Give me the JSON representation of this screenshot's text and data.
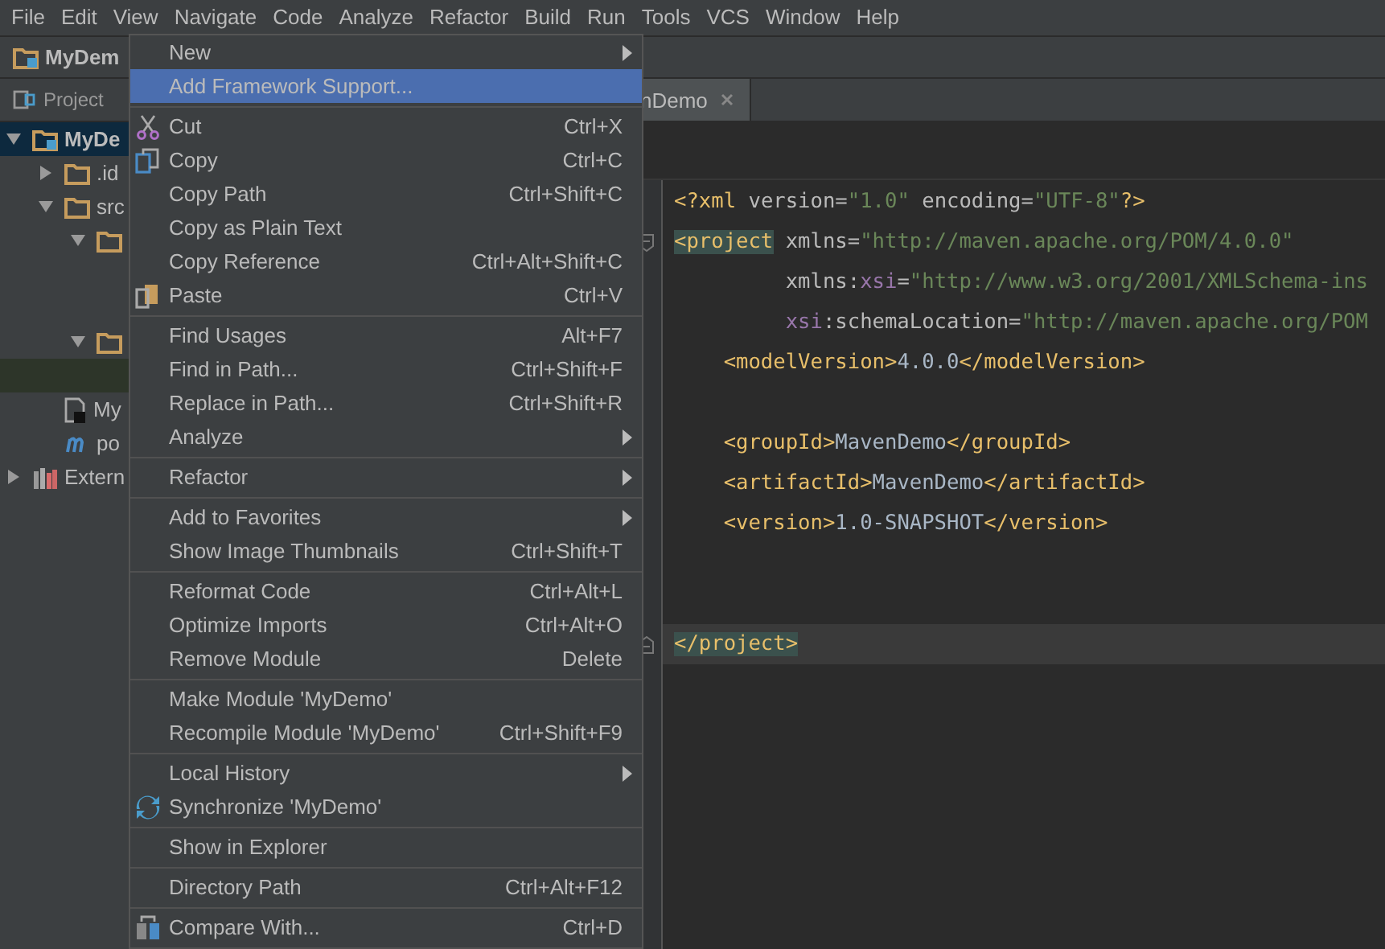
{
  "menu_bar": [
    {
      "label": "File",
      "selected": false
    },
    {
      "label": "Edit",
      "selected": false
    },
    {
      "label": "View",
      "selected": false
    },
    {
      "label": "Navigate",
      "selected": false
    },
    {
      "label": "Code",
      "selected": false
    },
    {
      "label": "Analyze",
      "selected": false
    },
    {
      "label": "Refactor",
      "selected": false
    },
    {
      "label": "Build",
      "selected": false
    },
    {
      "label": "Run",
      "selected": false
    },
    {
      "label": "Tools",
      "selected": false
    },
    {
      "label": "VCS",
      "selected": false
    },
    {
      "label": "Window",
      "selected": false
    },
    {
      "label": "Help",
      "selected": false
    }
  ],
  "nav_bar": {
    "crumb": "MyDem"
  },
  "tool_window": {
    "title": "Project"
  },
  "editor_tabs": [
    {
      "label": "nDemo",
      "selected": true
    }
  ],
  "tree": [
    {
      "kind": "module",
      "label": "MyDe",
      "expanded": true,
      "selected": true,
      "children": [
        {
          "kind": "folder",
          "label": ".id",
          "expanded": false,
          "selected": false
        },
        {
          "kind": "folder",
          "label": "src",
          "expanded": true,
          "selected": false,
          "children": [
            {
              "kind": "folder",
              "expanded": true,
              "selected": false,
              "children": [
                {
                  "kind": "hidden",
                  "selected": false
                },
                {
                  "kind": "hidden",
                  "selected": false
                }
              ]
            },
            {
              "kind": "folder",
              "expanded": true,
              "selected": false,
              "children": [
                {
                  "kind": "hidden",
                  "selected": true
                }
              ]
            }
          ]
        },
        {
          "kind": "file",
          "label": "My",
          "selected": false
        },
        {
          "kind": "maven",
          "label": "po",
          "selected": false
        }
      ]
    },
    {
      "kind": "library",
      "label": "Extern",
      "expanded": false,
      "selected": false
    }
  ],
  "context_menu": [
    {
      "kind": "item",
      "label": "New",
      "submenu": true,
      "selected": false
    },
    {
      "kind": "item",
      "label": "Add Framework Support...",
      "selected": true
    },
    {
      "kind": "separator"
    },
    {
      "kind": "item",
      "label": "Cut",
      "shortcut": "Ctrl+X",
      "selected": false
    },
    {
      "kind": "item",
      "label": "Copy",
      "shortcut": "Ctrl+C",
      "selected": false
    },
    {
      "kind": "item",
      "label": "Copy Path",
      "shortcut": "Ctrl+Shift+C",
      "selected": false
    },
    {
      "kind": "item",
      "label": "Copy as Plain Text",
      "selected": false
    },
    {
      "kind": "item",
      "label": "Copy Reference",
      "shortcut": "Ctrl+Alt+Shift+C",
      "selected": false
    },
    {
      "kind": "item",
      "label": "Paste",
      "shortcut": "Ctrl+V",
      "selected": false
    },
    {
      "kind": "separator"
    },
    {
      "kind": "item",
      "label": "Find Usages",
      "shortcut": "Alt+F7",
      "selected": false
    },
    {
      "kind": "item",
      "label": "Find in Path...",
      "shortcut": "Ctrl+Shift+F",
      "selected": false
    },
    {
      "kind": "item",
      "label": "Replace in Path...",
      "shortcut": "Ctrl+Shift+R",
      "selected": false
    },
    {
      "kind": "item",
      "label": "Analyze",
      "submenu": true,
      "selected": false
    },
    {
      "kind": "separator"
    },
    {
      "kind": "item",
      "label": "Refactor",
      "submenu": true,
      "selected": false
    },
    {
      "kind": "separator"
    },
    {
      "kind": "item",
      "label": "Add to Favorites",
      "submenu": true,
      "selected": false
    },
    {
      "kind": "item",
      "label": "Show Image Thumbnails",
      "shortcut": "Ctrl+Shift+T",
      "selected": false
    },
    {
      "kind": "separator"
    },
    {
      "kind": "item",
      "label": "Reformat Code",
      "shortcut": "Ctrl+Alt+L",
      "selected": false
    },
    {
      "kind": "item",
      "label": "Optimize Imports",
      "shortcut": "Ctrl+Alt+O",
      "selected": false
    },
    {
      "kind": "item",
      "label": "Remove Module",
      "shortcut": "Delete",
      "selected": false
    },
    {
      "kind": "separator"
    },
    {
      "kind": "item",
      "label": "Make Module 'MyDemo'",
      "selected": false
    },
    {
      "kind": "item",
      "label": "Recompile Module 'MyDemo'",
      "shortcut": "Ctrl+Shift+F9",
      "selected": false
    },
    {
      "kind": "separator"
    },
    {
      "kind": "item",
      "label": "Local History",
      "submenu": true,
      "selected": false
    },
    {
      "kind": "item",
      "label": "Synchronize 'MyDemo'",
      "selected": false
    },
    {
      "kind": "separator"
    },
    {
      "kind": "item",
      "label": "Show in Explorer",
      "selected": false
    },
    {
      "kind": "separator"
    },
    {
      "kind": "item",
      "label": "Directory Path",
      "shortcut": "Ctrl+Alt+F12",
      "selected": false
    },
    {
      "kind": "separator"
    },
    {
      "kind": "item",
      "label": "Compare With...",
      "shortcut": "Ctrl+D",
      "selected": false
    },
    {
      "kind": "separator"
    }
  ],
  "code_lines": [
    {
      "current": false,
      "fold": false,
      "tokens": [
        {
          "kind": "tag",
          "text": "<?xml "
        },
        {
          "kind": "attr",
          "text": "version="
        },
        {
          "kind": "string",
          "text": "\"1.0\""
        },
        {
          "kind": "attr",
          "text": " encoding="
        },
        {
          "kind": "string",
          "text": "\"UTF-8\""
        },
        {
          "kind": "tag",
          "text": "?>"
        }
      ]
    },
    {
      "current": false,
      "fold": true,
      "tokens": [
        {
          "kind": "tag-match",
          "text": "<project"
        },
        {
          "kind": "attr",
          "text": " xmlns="
        },
        {
          "kind": "string",
          "text": "\"http://maven.apache.org/POM/4.0.0\""
        }
      ]
    },
    {
      "current": false,
      "fold": false,
      "tokens": [
        {
          "kind": "attr",
          "text": "         xmlns:"
        },
        {
          "kind": "ns",
          "text": "xsi"
        },
        {
          "kind": "attr",
          "text": "="
        },
        {
          "kind": "string",
          "text": "\"http://www.w3.org/2001/XMLSchema-ins"
        }
      ]
    },
    {
      "current": false,
      "fold": false,
      "tokens": [
        {
          "kind": "ns",
          "text": "         xsi"
        },
        {
          "kind": "attr",
          "text": ":schemaLocation="
        },
        {
          "kind": "string",
          "text": "\"http://maven.apache.org/POM"
        }
      ]
    },
    {
      "current": false,
      "fold": false,
      "tokens": [
        {
          "kind": "tag",
          "text": "    <modelVersion>"
        },
        {
          "kind": "text",
          "text": "4.0.0"
        },
        {
          "kind": "tag",
          "text": "</modelVersion>"
        }
      ]
    },
    {
      "current": false,
      "fold": false
    },
    {
      "current": false,
      "fold": false,
      "tokens": [
        {
          "kind": "tag",
          "text": "    <groupId>"
        },
        {
          "kind": "text",
          "text": "MavenDemo"
        },
        {
          "kind": "tag",
          "text": "</groupId>"
        }
      ]
    },
    {
      "current": false,
      "fold": false,
      "tokens": [
        {
          "kind": "tag",
          "text": "    <artifactId>"
        },
        {
          "kind": "text",
          "text": "MavenDemo"
        },
        {
          "kind": "tag",
          "text": "</artifactId>"
        }
      ]
    },
    {
      "current": false,
      "fold": false,
      "tokens": [
        {
          "kind": "tag",
          "text": "    <version>"
        },
        {
          "kind": "text",
          "text": "1.0-SNAPSHOT"
        },
        {
          "kind": "tag",
          "text": "</version>"
        }
      ]
    },
    {
      "current": false,
      "fold": false
    },
    {
      "current": false,
      "fold": false
    },
    {
      "current": true,
      "fold": true,
      "tokens": [
        {
          "kind": "tag-match",
          "text": "</project>"
        }
      ]
    }
  ]
}
